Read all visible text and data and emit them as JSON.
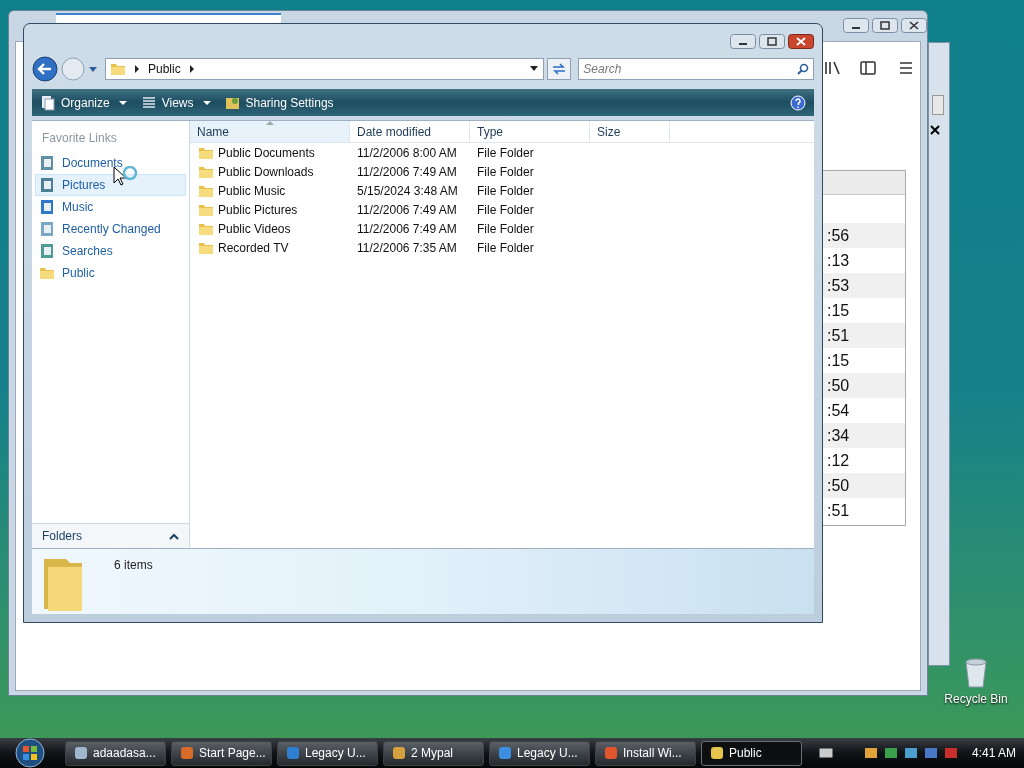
{
  "background_window": {
    "times": [
      ":56",
      ":13",
      ":53",
      ":15",
      ":51",
      ":15",
      ":50",
      ":54",
      ":34",
      ":12",
      ":50",
      ":51"
    ]
  },
  "explorer": {
    "address": {
      "path": [
        "Public"
      ]
    },
    "search": {
      "placeholder": "Search"
    },
    "toolbar": [
      {
        "label": "Organize",
        "kind": "menu"
      },
      {
        "label": "Views",
        "kind": "menu"
      },
      {
        "label": "Sharing Settings",
        "kind": "button"
      }
    ],
    "favorite_links": {
      "heading": "Favorite Links",
      "items": [
        {
          "label": "Documents",
          "selected": false
        },
        {
          "label": "Pictures",
          "selected": true
        },
        {
          "label": "Music",
          "selected": false
        },
        {
          "label": "Recently Changed",
          "selected": false
        },
        {
          "label": "Searches",
          "selected": false
        },
        {
          "label": "Public",
          "selected": false
        }
      ]
    },
    "folders_bar": "Folders",
    "columns": [
      "Name",
      "Date modified",
      "Type",
      "Size"
    ],
    "rows": [
      {
        "name": "Public Documents",
        "date": "11/2/2006 8:00 AM",
        "type": "File Folder"
      },
      {
        "name": "Public Downloads",
        "date": "11/2/2006 7:49 AM",
        "type": "File Folder"
      },
      {
        "name": "Public Music",
        "date": "5/15/2024 3:48 AM",
        "type": "File Folder"
      },
      {
        "name": "Public Pictures",
        "date": "11/2/2006 7:49 AM",
        "type": "File Folder"
      },
      {
        "name": "Public Videos",
        "date": "11/2/2006 7:49 AM",
        "type": "File Folder"
      },
      {
        "name": "Recorded TV",
        "date": "11/2/2006 7:35 AM",
        "type": "File Folder"
      }
    ],
    "details": "6 items"
  },
  "desktop_icons": [
    {
      "label": "Recycle Bin"
    }
  ],
  "taskbar": {
    "buttons": [
      {
        "label": "adaadasa...",
        "selected": false
      },
      {
        "label": "Start Page...",
        "selected": false
      },
      {
        "label": "Legacy U...",
        "selected": false
      },
      {
        "label": "2 Mypal",
        "selected": false
      },
      {
        "label": "Legacy U...",
        "selected": false
      },
      {
        "label": "Install Wi...",
        "selected": false
      },
      {
        "label": "Public",
        "selected": true
      }
    ],
    "clock": "4:41 AM"
  }
}
